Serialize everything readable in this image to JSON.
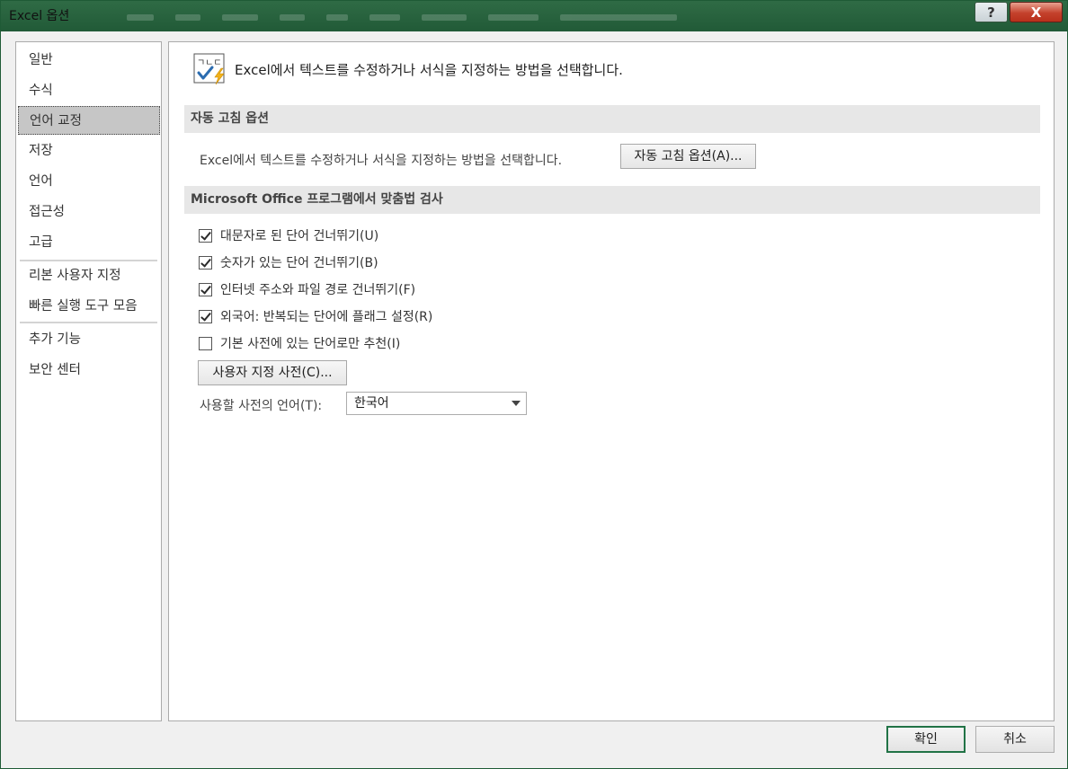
{
  "window": {
    "title": "Excel 옵션",
    "help_label": "?",
    "close_label": "X"
  },
  "sidebar": {
    "items": [
      {
        "label": "일반"
      },
      {
        "label": "수식"
      },
      {
        "label": "언어 교정",
        "selected": true
      },
      {
        "label": "저장"
      },
      {
        "label": "언어"
      },
      {
        "label": "접근성"
      },
      {
        "label": "고급"
      },
      {
        "label": "리본 사용자 지정"
      },
      {
        "label": "빠른 실행 도구 모음"
      },
      {
        "label": "추가 기능"
      },
      {
        "label": "보안 센터"
      }
    ]
  },
  "main": {
    "header_text": "Excel에서 텍스트를 수정하거나 서식을 지정하는 방법을 선택합니다.",
    "header_icon_glyphs": "ㄱㄴㄷ",
    "autocorrect_section": {
      "title": "자동 고침 옵션",
      "description": "Excel에서 텍스트를 수정하거나 서식을 지정하는 방법을 선택합니다.",
      "button_label": "자동 고침 옵션(A)..."
    },
    "spelling_section": {
      "title": "Microsoft Office 프로그램에서 맞춤법 검사",
      "options": [
        {
          "label": "대문자로 된 단어 건너뛰기(U)",
          "checked": true
        },
        {
          "label": "숫자가 있는 단어 건너뛰기(B)",
          "checked": true
        },
        {
          "label": "인터넷 주소와 파일 경로 건너뛰기(F)",
          "checked": true
        },
        {
          "label": "외국어: 반복되는 단어에 플래그 설정(R)",
          "checked": true
        },
        {
          "label": "기본 사전에 있는 단어로만 추천(I)",
          "checked": false
        }
      ],
      "custom_dictionary_button": "사용자 지정 사전(C)...",
      "dictionary_language_label": "사용할 사전의 언어(T):",
      "dictionary_language_value": "한국어"
    }
  },
  "footer": {
    "ok_label": "확인",
    "cancel_label": "취소"
  },
  "colors": {
    "title_bar": "#215a37",
    "default_button_border": "#217346",
    "section_header_bg": "#e7e7e7",
    "selected_nav_bg": "#c6c6c6"
  }
}
